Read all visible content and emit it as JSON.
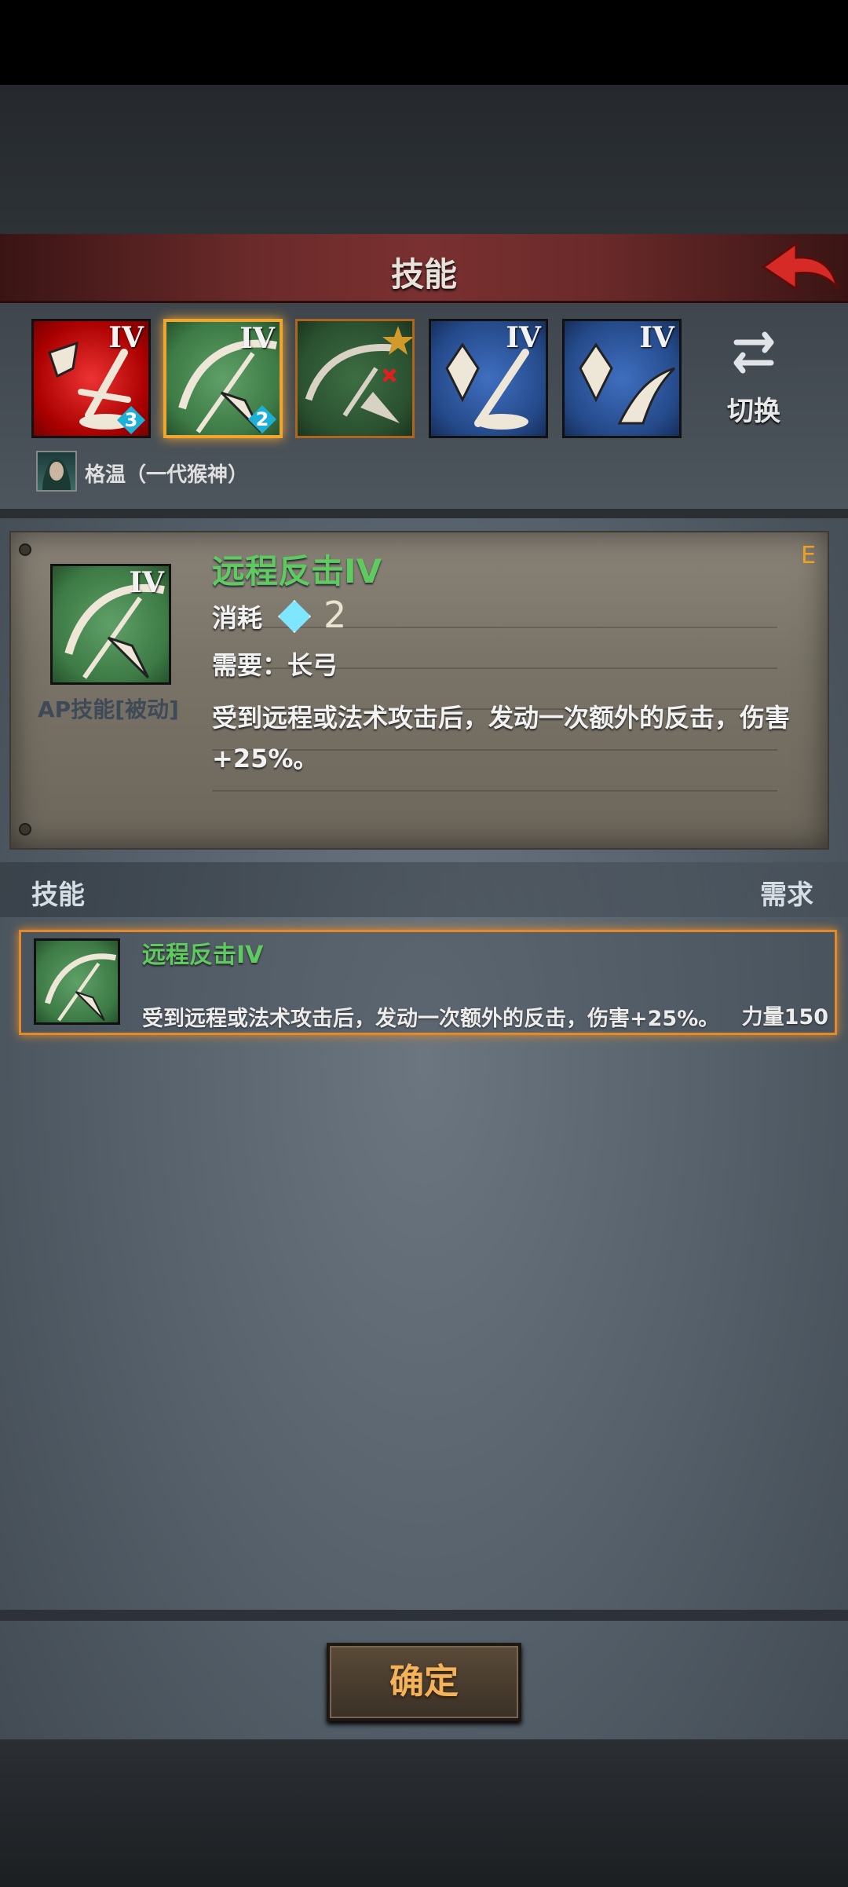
{
  "header": {
    "title": "技能"
  },
  "skill_slots": [
    {
      "roman": "IV",
      "badge": "3",
      "color": "#c01818"
    },
    {
      "roman": "IV",
      "badge": "2",
      "color": "#3d7a45",
      "selected": true
    },
    {
      "roman": "",
      "badge": "",
      "color": "#2a5030",
      "icons": [
        "star-icon",
        "x-icon"
      ]
    },
    {
      "roman": "IV",
      "badge": "",
      "color": "#254a8a"
    },
    {
      "roman": "IV",
      "badge": "",
      "color": "#254a8a"
    }
  ],
  "switch": {
    "label": "切换"
  },
  "character": {
    "name": "格温（一代猴神）"
  },
  "detail": {
    "grade": "E",
    "icon_roman": "IV",
    "type_label": "AP技能[被动]",
    "name": "远程反击IV",
    "cost_label": "消耗",
    "cost_value": "2",
    "requirement": "需要：长弓",
    "description": "受到远程或法术攻击后，发动一次额外的反击，伤害+25%。"
  },
  "list": {
    "col_skill": "技能",
    "col_requirement": "需求",
    "rows": [
      {
        "name": "远程反击IV",
        "description": "受到远程或法术攻击后，发动一次额外的反击，伤害+25%。",
        "requirement": "力量150"
      }
    ]
  },
  "confirm": {
    "label": "确定"
  },
  "colors": {
    "accent_orange": "#e38a2a",
    "skill_green": "#5fca5f",
    "header_red": "#7a3030"
  }
}
